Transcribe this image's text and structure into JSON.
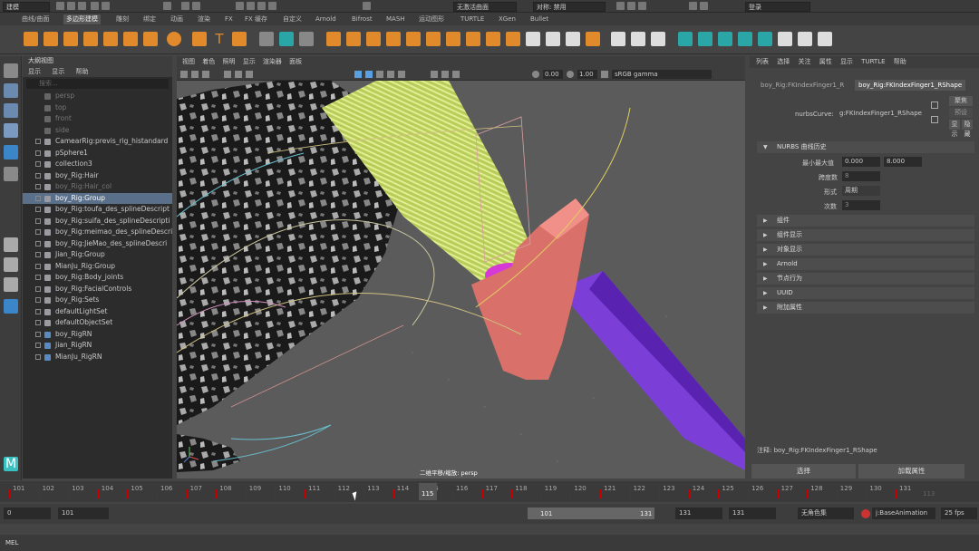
{
  "topbar": {
    "mode": "建模",
    "curve": "无激活曲面",
    "symmetry": "对称: 禁用",
    "login": "登录"
  },
  "shelf_tabs": [
    "曲线/曲面",
    "多边形建模",
    "雕刻",
    "绑定",
    "动画",
    "渲染",
    "FX",
    "FX 缓存",
    "自定义",
    "Arnold",
    "Bifrost",
    "MASH",
    "运动图形",
    "TURTLE",
    "XGen",
    "Bullet"
  ],
  "outliner": {
    "title": "大纲视图",
    "menu": [
      "显示",
      "显示",
      "帮助"
    ],
    "search_placeholder": "搜索...",
    "items": [
      {
        "label": "persp",
        "dim": true
      },
      {
        "label": "top",
        "dim": true
      },
      {
        "label": "front",
        "dim": true
      },
      {
        "label": "side",
        "dim": true
      },
      {
        "label": "CamearRig:previs_rig_histandard"
      },
      {
        "label": "pSphere1"
      },
      {
        "label": "collection3"
      },
      {
        "label": "boy_Rig:Hair"
      },
      {
        "label": "boy_Rig:Hair_col",
        "dim": true
      },
      {
        "label": "boy_Rig:Group",
        "sel": true
      },
      {
        "label": "boy_Rig:toufa_des_splineDescript"
      },
      {
        "label": "boy_Rig:suifa_des_splineDescripti"
      },
      {
        "label": "boy_Rig:meimao_des_splineDescri"
      },
      {
        "label": "boy_Rig:JieMao_des_splineDescri"
      },
      {
        "label": "Jian_Rig:Group"
      },
      {
        "label": "MianJu_Rig:Group"
      },
      {
        "label": "boy_Rig:Body_joints"
      },
      {
        "label": "boy_Rig:FacialControls"
      },
      {
        "label": "boy_Rig:Sets"
      },
      {
        "label": "defaultLightSet"
      },
      {
        "label": "defaultObjectSet"
      },
      {
        "label": "boy_RigRN"
      },
      {
        "label": "Jian_RigRN"
      },
      {
        "label": "MianJu_RigRN"
      }
    ]
  },
  "viewport": {
    "menu": [
      "视图",
      "着色",
      "照明",
      "显示",
      "渲染器",
      "面板"
    ],
    "exposure": "0.00",
    "gamma": "1.00",
    "colorspace": "sRGB gamma",
    "camera_label": "二维平移/缩放: persp"
  },
  "attr_editor": {
    "menu": [
      "列表",
      "选择",
      "关注",
      "属性",
      "显示",
      "TURTLE",
      "帮助"
    ],
    "tabs": [
      "boy_Rig:FKIndexFinger1_R",
      "boy_Rig:FKIndexFinger1_RShape"
    ],
    "focus_label": "聚焦",
    "preset_label": "预设",
    "show_label": "显示",
    "hide_label": "隐藏",
    "node_label": "nurbsCurve:",
    "node_value": "g:FKIndexFinger1_RShape",
    "section_open": "NURBS 曲线历史",
    "minmax_label": "最小最大值",
    "min_value": "0.000",
    "max_value": "8.000",
    "spans_label": "跨度数",
    "spans_value": "8",
    "form_label": "形式",
    "form_value": "周期",
    "degree_label": "次数",
    "degree_value": "3",
    "sections": [
      "组件",
      "组件显示",
      "对象显示",
      "Arnold",
      "节点行为",
      "UUID",
      "附加属性"
    ],
    "notes": "注释: boy_Rig:FKIndexFinger1_RShape",
    "select_btn": "选择",
    "load_btn": "加载属性"
  },
  "timeline": {
    "ticks": [
      "101",
      "102",
      "103",
      "104",
      "105",
      "106",
      "107",
      "108",
      "109",
      "110",
      "111",
      "112",
      "113",
      "114",
      "115",
      "116",
      "117",
      "118",
      "119",
      "120",
      "121",
      "122",
      "123",
      "124",
      "125",
      "126",
      "127",
      "128",
      "129",
      "130",
      "131"
    ],
    "current": "115",
    "end_ghost": "113"
  },
  "range": {
    "start": "0",
    "anim_start": "101",
    "play_start": "101",
    "play_end": "131",
    "anim_end": "131",
    "end": "131",
    "character": "无角色集",
    "layer": "j:BaseAnimation",
    "fps": "25 fps"
  },
  "cmdline": {
    "label": "MEL"
  },
  "colors": {
    "accent": "#5a6f8a",
    "green_coil": "#c8dc6a",
    "salmon_guard": "#d9706a",
    "purple_blade": "#7b3fd8",
    "magenta_ring": "#d63ad6"
  }
}
